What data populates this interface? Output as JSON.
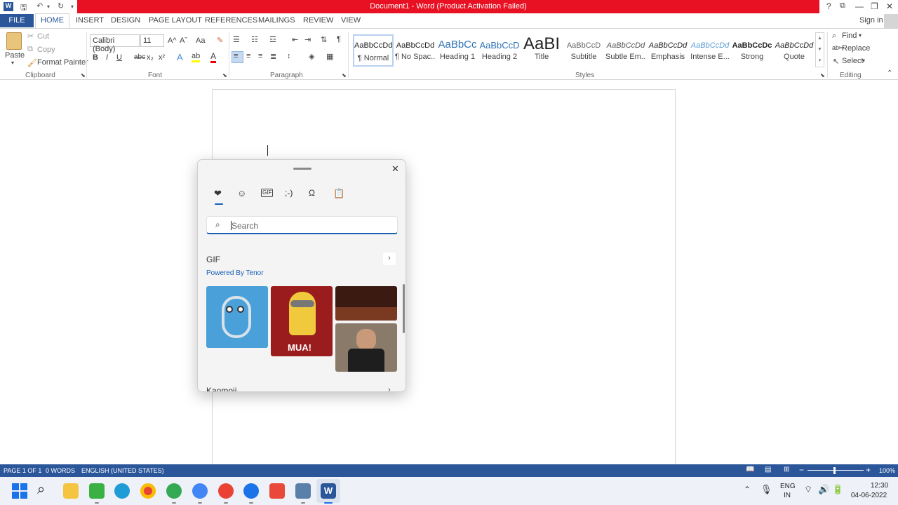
{
  "window": {
    "title": "Document1 - Word (Product Activation Failed)",
    "help": "?",
    "sign_in": "Sign in"
  },
  "tabs": [
    "FILE",
    "HOME",
    "INSERT",
    "DESIGN",
    "PAGE LAYOUT",
    "REFERENCES",
    "MAILINGS",
    "REVIEW",
    "VIEW"
  ],
  "clipboard": {
    "paste": "Paste",
    "cut": "Cut",
    "copy": "Copy",
    "format_painter": "Format Painter",
    "label": "Clipboard"
  },
  "font": {
    "name": "Calibri (Body)",
    "size": "11",
    "label": "Font",
    "bold": "B",
    "italic": "I",
    "underline": "U",
    "strike": "abc",
    "sub": "x₂",
    "sup": "x²",
    "grow": "A^",
    "shrink": "Aˇ",
    "case": "Aa"
  },
  "paragraph": {
    "label": "Paragraph",
    "pilcrow": "¶"
  },
  "styles": {
    "label": "Styles",
    "items": [
      {
        "sample": "AaBbCcDd",
        "name": "¶ Normal"
      },
      {
        "sample": "AaBbCcDd",
        "name": "¶ No Spac..."
      },
      {
        "sample": "AaBbCc",
        "name": "Heading 1"
      },
      {
        "sample": "AaBbCcD",
        "name": "Heading 2"
      },
      {
        "sample": "AaBI",
        "name": "Title"
      },
      {
        "sample": "AaBbCcD",
        "name": "Subtitle"
      },
      {
        "sample": "AaBbCcDd",
        "name": "Subtle Em..."
      },
      {
        "sample": "AaBbCcDd",
        "name": "Emphasis"
      },
      {
        "sample": "AaBbCcDd",
        "name": "Intense E..."
      },
      {
        "sample": "AaBbCcDc",
        "name": "Strong"
      },
      {
        "sample": "AaBbCcDd",
        "name": "Quote"
      }
    ]
  },
  "editing": {
    "find": "Find",
    "replace": "Replace",
    "select": "Select",
    "label": "Editing"
  },
  "emoji_panel": {
    "search_placeholder": "Search",
    "gif_heading": "GIF",
    "powered_by": "Powered By Tenor",
    "gif_text": "MUA!",
    "next_section": "Kaomoji",
    "tabs": [
      "favorites-icon",
      "emoji-icon",
      "gif-icon",
      "kaomoji-icon",
      "symbols-icon",
      "clipboard-history-icon"
    ]
  },
  "status": {
    "page": "PAGE 1 OF 1",
    "words": "0 WORDS",
    "language": "ENGLISH (UNITED STATES)",
    "zoom": "100%"
  },
  "taskbar": {
    "lang_top": "ENG",
    "lang_bottom": "IN",
    "time": "12:30",
    "date": "04-06-2022"
  },
  "colors": {
    "word_blue": "#2b579a",
    "alert_red": "#e81123",
    "tenor_blue": "#1a5fb4"
  }
}
